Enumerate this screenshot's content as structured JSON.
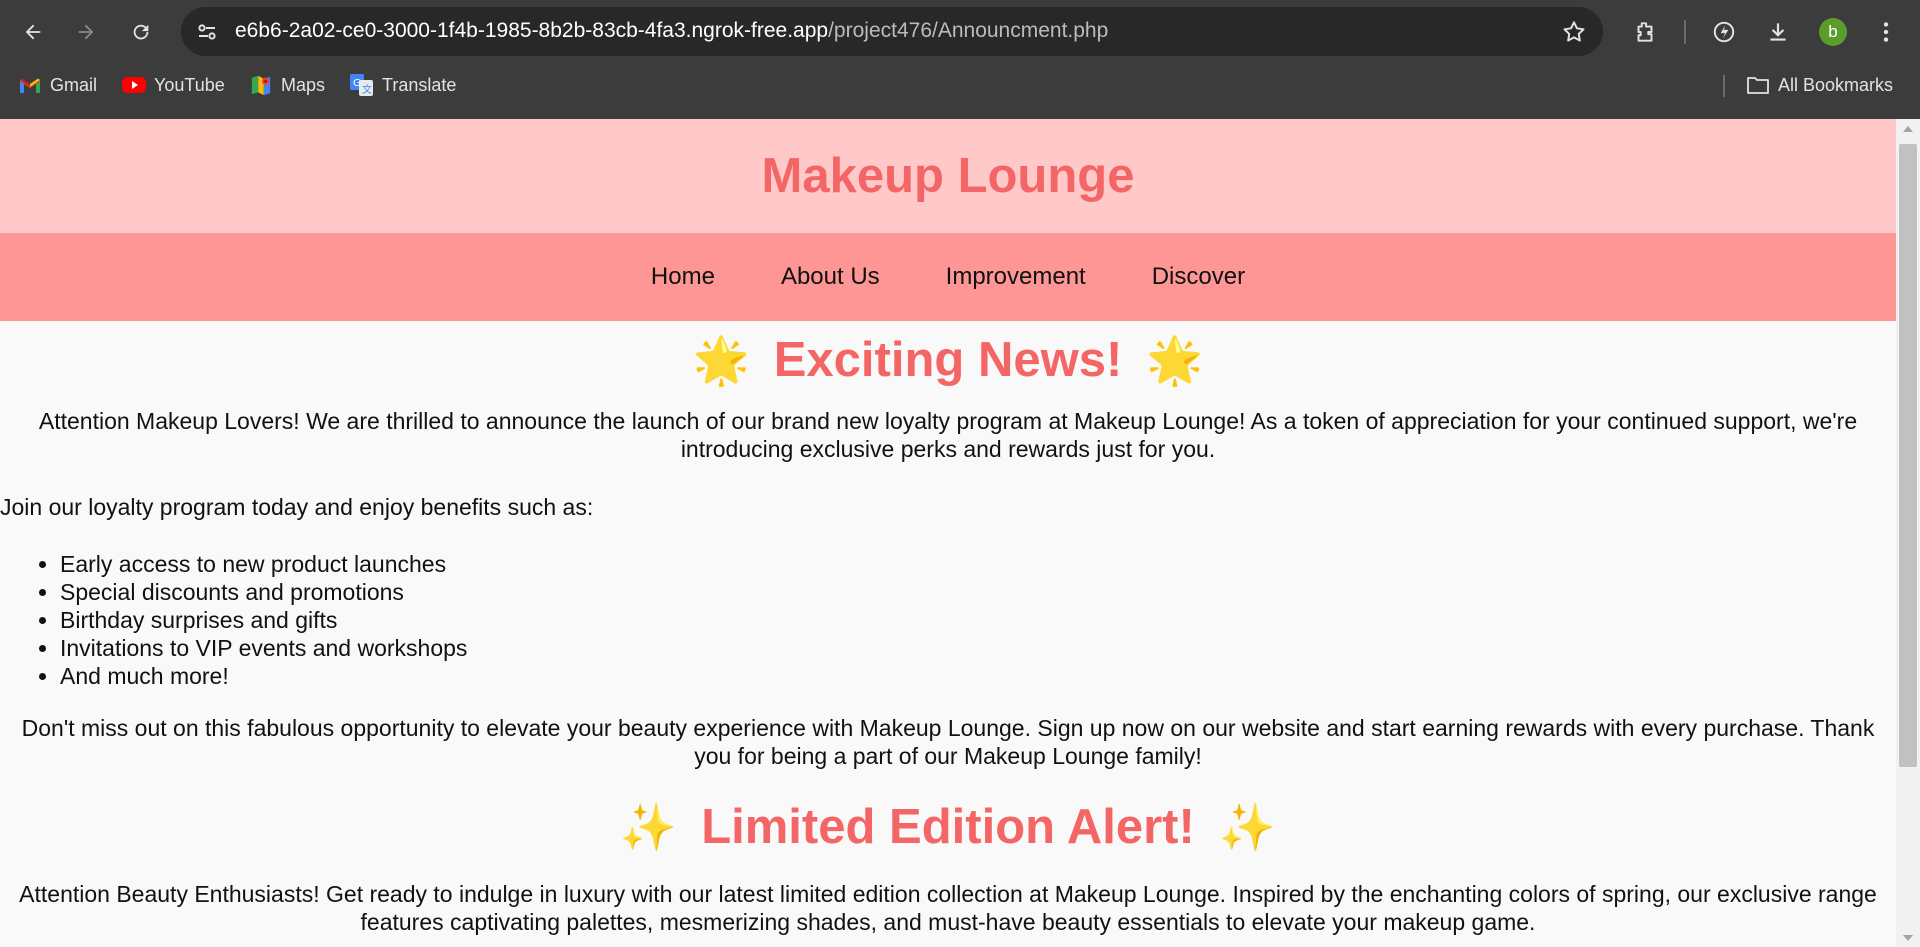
{
  "browser": {
    "url_host": "e6b6-2a02-ce0-3000-1f4b-1985-8b2b-83cb-4fa3.ngrok-free.app",
    "url_path": "/project476/Announcment.php",
    "profile_initial": "b",
    "bookmarks": [
      {
        "label": "Gmail",
        "icon": "gmail-icon"
      },
      {
        "label": "YouTube",
        "icon": "youtube-icon"
      },
      {
        "label": "Maps",
        "icon": "maps-icon"
      },
      {
        "label": "Translate",
        "icon": "translate-icon"
      }
    ],
    "all_bookmarks_label": "All Bookmarks"
  },
  "site": {
    "title": "Makeup Lounge",
    "nav": [
      "Home",
      "About Us",
      "Improvement",
      "Discover"
    ]
  },
  "announcement1": {
    "heading": "Exciting News!",
    "emoji": "🌟",
    "intro": "Attention Makeup Lovers! We are thrilled to announce the launch of our brand new loyalty program at Makeup Lounge! As a token of appreciation for your continued support, we're introducing exclusive perks and rewards just for you.",
    "join_text": "Join our loyalty program today and enjoy benefits such as:",
    "benefits": [
      "Early access to new product launches",
      "Special discounts and promotions",
      "Birthday surprises and gifts",
      "Invitations to VIP events and workshops",
      "And much more!"
    ],
    "outro": "Don't miss out on this fabulous opportunity to elevate your beauty experience with Makeup Lounge. Sign up now on our website and start earning rewards with every purchase. Thank you for being a part of our Makeup Lounge family!"
  },
  "announcement2": {
    "heading": "Limited Edition Alert!",
    "emoji": "✨",
    "intro": "Attention Beauty Enthusiasts! Get ready to indulge in luxury with our latest limited edition collection at Makeup Lounge. Inspired by the enchanting colors of spring, our exclusive range features captivating palettes, mesmerizing shades, and must-have beauty essentials to elevate your makeup game."
  },
  "colors": {
    "header_bg": "#ffc9c9",
    "nav_bg": "#ff9696",
    "accent": "#f46566",
    "chrome_bg": "#3c3c3c"
  }
}
